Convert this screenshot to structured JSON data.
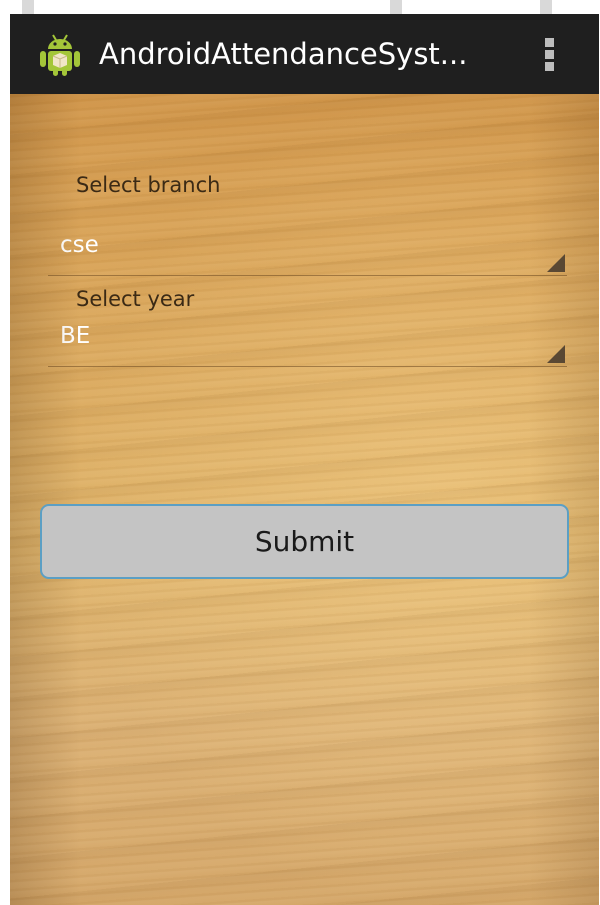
{
  "action_bar": {
    "title": "AndroidAttendanceSyst...",
    "app_icon": "android-robot-icon",
    "overflow_icon": "overflow-menu-icon"
  },
  "form": {
    "branch_label": "Select branch",
    "branch_value": "cse",
    "year_label": "Select year",
    "year_value": "BE",
    "submit_label": "Submit"
  },
  "colors": {
    "action_bar_bg": "#1f1f1f",
    "button_bg": "#c4c4c4",
    "button_border": "#5b9fc4",
    "android_green": "#a4c639"
  }
}
